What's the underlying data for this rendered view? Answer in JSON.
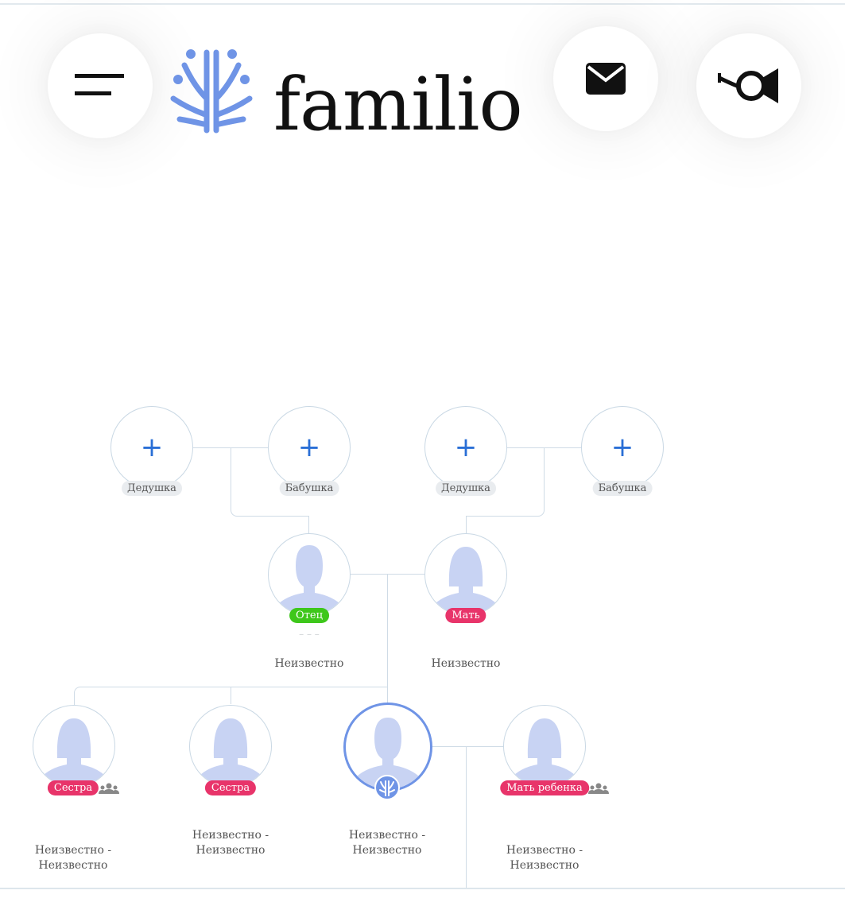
{
  "header": {
    "logo_text": "familio",
    "menu_icon": "menu-icon",
    "mail_icon": "mail-icon",
    "post_icon": "post-horn-icon"
  },
  "colors": {
    "logo_blue": "#6f94e6",
    "father_badge": "#3ec71b",
    "female_badge": "#e8346a",
    "connector": "#cfdbe6"
  },
  "tree": {
    "grandparents": [
      {
        "label": "Дедушка"
      },
      {
        "label": "Бабушка"
      },
      {
        "label": "Дедушка"
      },
      {
        "label": "Бабушка"
      }
    ],
    "father": {
      "badge": "Отец",
      "dates": "Неизвестно"
    },
    "mother": {
      "badge": "Мать",
      "dates": "Неизвестно"
    },
    "children": [
      {
        "badge": "Сестра",
        "dates_1": "Неизвестно -",
        "dates_2": "Неизвестно"
      },
      {
        "badge": "Сестра",
        "dates_1": "Неизвестно -",
        "dates_2": "Неизвестно"
      },
      {
        "dates_1": "Неизвестно -",
        "dates_2": "Неизвестно"
      },
      {
        "badge": "Мать ребенка",
        "dates_1": "Неизвестно -",
        "dates_2": "Неизвестно"
      }
    ]
  }
}
